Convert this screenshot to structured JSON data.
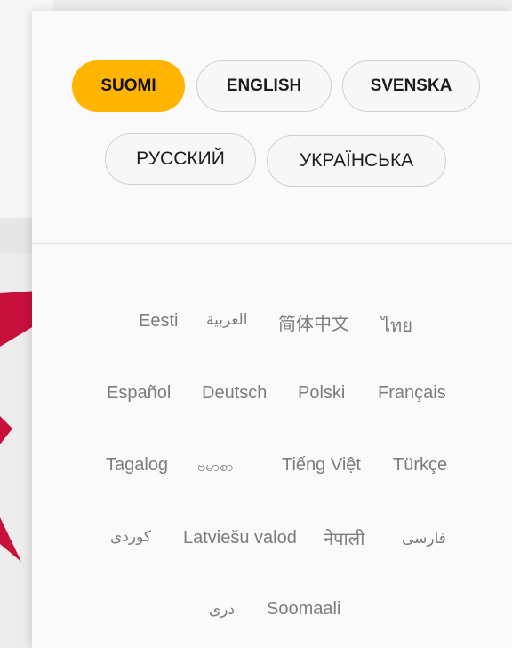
{
  "primary_languages": [
    {
      "label": "SUOMI",
      "active": true
    },
    {
      "label": "ENGLISH",
      "active": false
    },
    {
      "label": "SVENSKA",
      "active": false
    },
    {
      "label": "РУССКИЙ",
      "active": false
    },
    {
      "label": "УКРАЇНСЬКА",
      "active": false
    }
  ],
  "other_languages": [
    "Eesti",
    "العربية",
    "简体中文",
    "ไทย",
    "Español",
    "Deutsch",
    "Polski",
    "Français",
    "Tagalog",
    "ဗမာစာ",
    "Tiếng Việt",
    "Türkçe",
    "کوردی",
    "Latviešu valod",
    "नेपाली",
    "فارسی",
    "دری",
    "Soomaali"
  ],
  "colors": {
    "active_pill": "#ffb400",
    "accent_shape": "#c8103c"
  }
}
